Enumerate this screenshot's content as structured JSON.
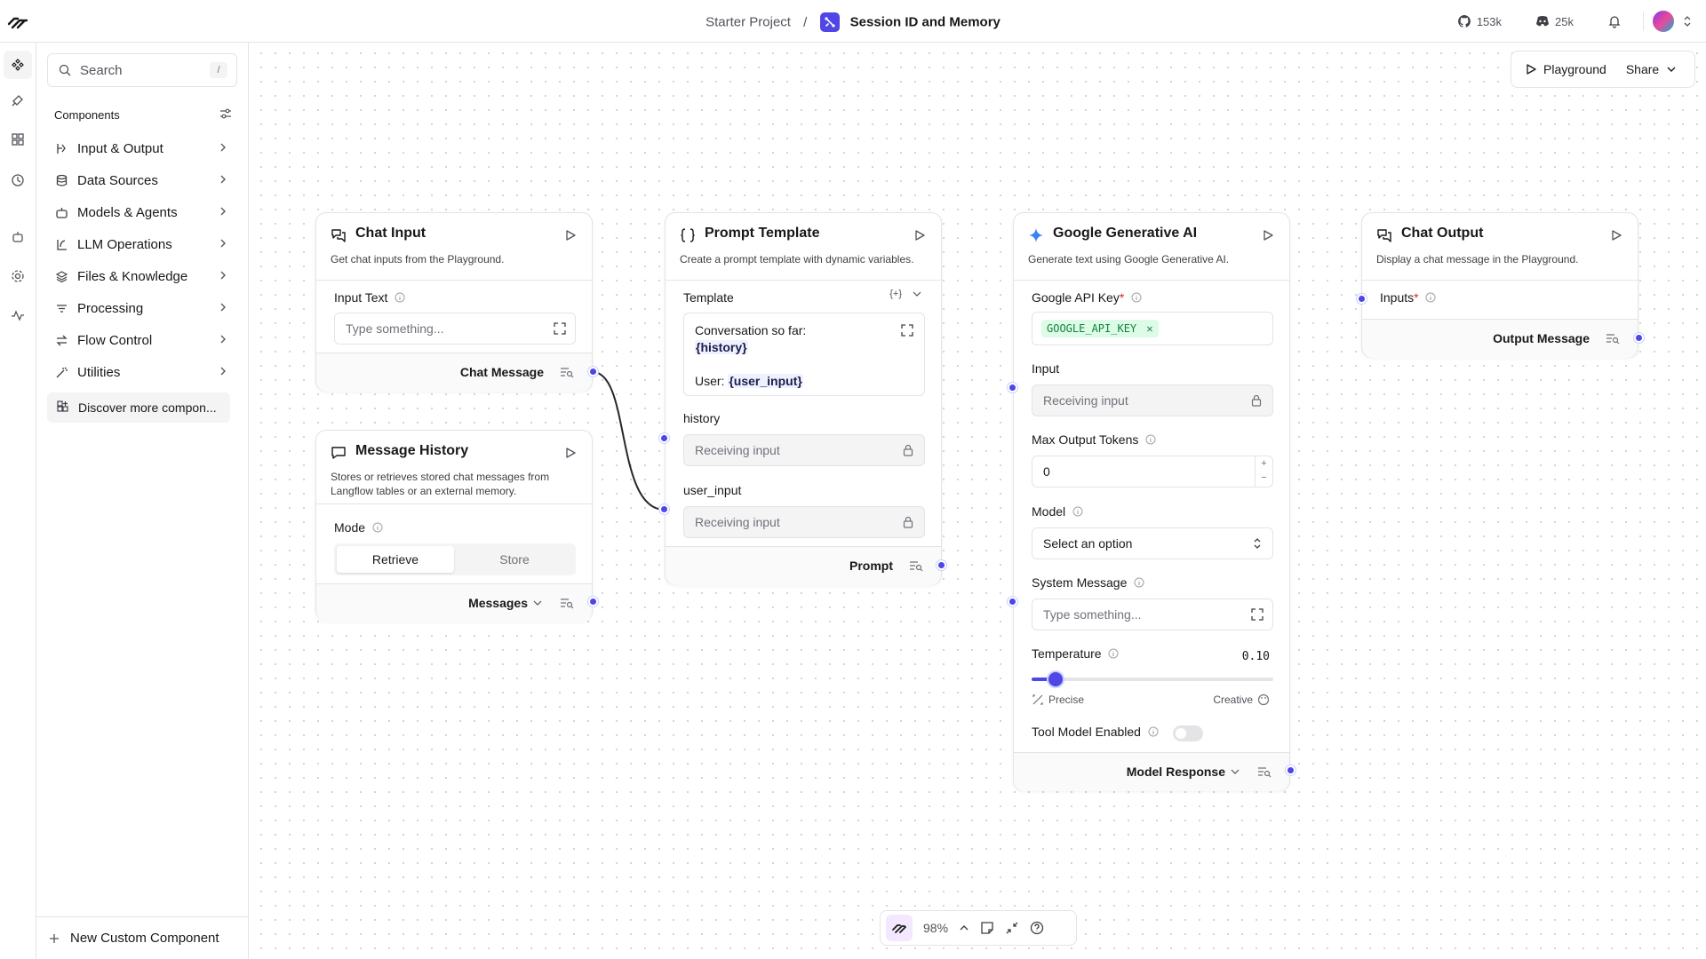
{
  "header": {
    "project": "Starter Project",
    "separator": "/",
    "flow_title": "Session ID and Memory",
    "github_count": "153k",
    "discord_count": "25k"
  },
  "sidebar": {
    "search_placeholder": "Search",
    "search_shortcut": "/",
    "section_title": "Components",
    "categories": [
      {
        "label": "Input & Output",
        "icon": "input-output-icon"
      },
      {
        "label": "Data Sources",
        "icon": "database-icon"
      },
      {
        "label": "Models & Agents",
        "icon": "robot-icon"
      },
      {
        "label": "LLM Operations",
        "icon": "llm-icon"
      },
      {
        "label": "Files & Knowledge",
        "icon": "layers-icon"
      },
      {
        "label": "Processing",
        "icon": "filter-icon"
      },
      {
        "label": "Flow Control",
        "icon": "arrows-icon"
      },
      {
        "label": "Utilities",
        "icon": "wand-icon"
      }
    ],
    "discover_label": "Discover more compon...",
    "new_component_label": "New Custom Component"
  },
  "toolbar": {
    "playground_label": "Playground",
    "share_label": "Share"
  },
  "nodes": {
    "chat_input": {
      "title": "Chat Input",
      "description": "Get chat inputs from the Playground.",
      "field_label": "Input Text",
      "field_placeholder": "Type something...",
      "output_label": "Chat Message"
    },
    "message_history": {
      "title": "Message History",
      "description": "Stores or retrieves stored chat messages from Langflow tables or an external memory.",
      "mode_label": "Mode",
      "mode_options": [
        "Retrieve",
        "Store"
      ],
      "mode_selected": "Retrieve",
      "output_label": "Messages"
    },
    "prompt_template": {
      "title": "Prompt Template",
      "description": "Create a prompt template with dynamic variables.",
      "template_label": "Template",
      "template_line1": "Conversation so far:",
      "template_var1": "{history}",
      "template_line2": "User: ",
      "template_var2": "{user_input}",
      "tools_label": "{+}",
      "history_label": "history",
      "history_placeholder": "Receiving input",
      "user_input_label": "user_input",
      "user_input_placeholder": "Receiving input",
      "output_label": "Prompt"
    },
    "google_ai": {
      "title": "Google Generative AI",
      "description": "Generate text using Google Generative AI.",
      "api_key_label": "Google API Key",
      "api_key_value": "GOOGLE_API_KEY",
      "input_label": "Input",
      "input_placeholder": "Receiving input",
      "max_tokens_label": "Max Output Tokens",
      "max_tokens_value": "0",
      "model_label": "Model",
      "model_placeholder": "Select an option",
      "system_label": "System Message",
      "system_placeholder": "Type something...",
      "temperature_label": "Temperature",
      "temperature_value": "0.10",
      "temperature_fraction": 0.1,
      "precise_label": "Precise",
      "creative_label": "Creative",
      "tool_label": "Tool Model Enabled",
      "tool_enabled": false,
      "output_label": "Model Response"
    },
    "chat_output": {
      "title": "Chat Output",
      "description": "Display a chat message in the Playground.",
      "inputs_label": "Inputs",
      "output_label": "Output Message"
    }
  },
  "canvas_controls": {
    "zoom": "98%"
  },
  "colors": {
    "accent": "#4f46e5",
    "chip_bg": "#dcfce7",
    "chip_text": "#15803d",
    "required": "#dc2626"
  }
}
